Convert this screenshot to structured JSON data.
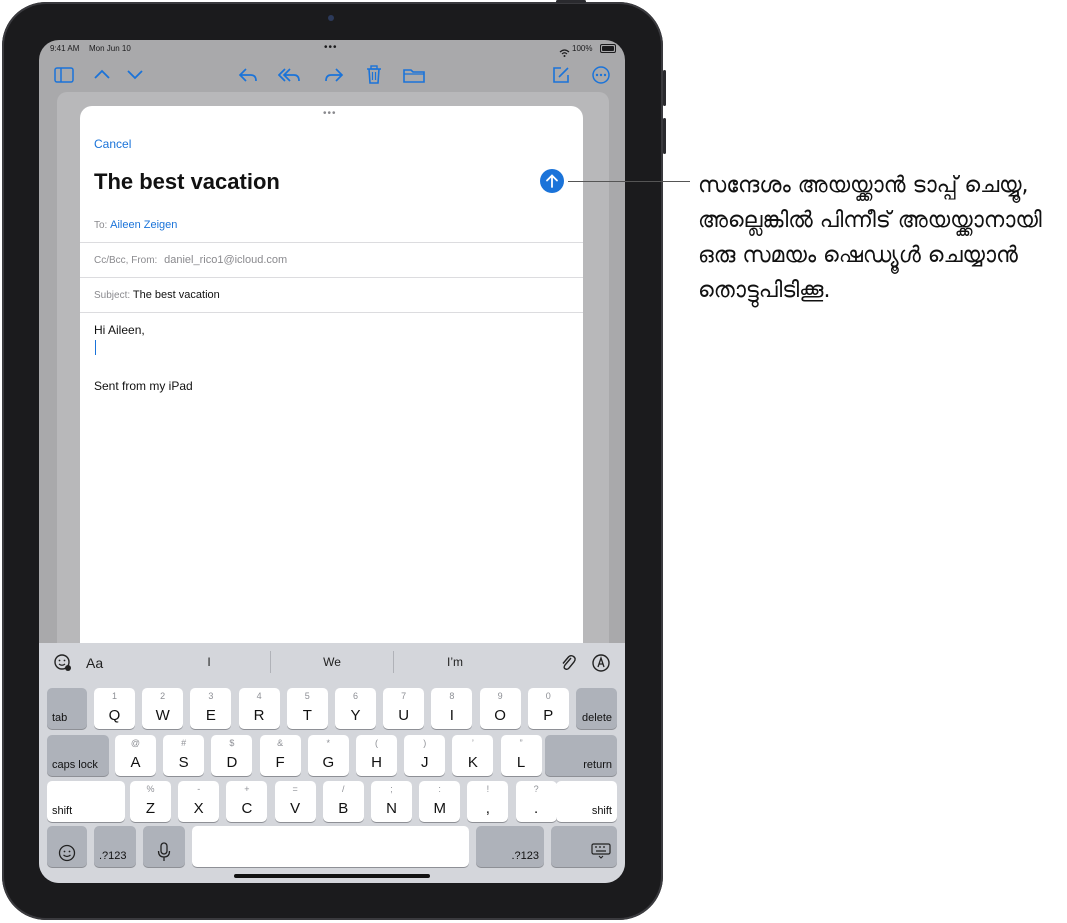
{
  "status": {
    "time": "9:41 AM",
    "date": "Mon Jun 10",
    "battery": "100%"
  },
  "toolbar_icons": [
    "sidebar-icon",
    "chevron-up-icon",
    "chevron-down-icon",
    "reply-icon",
    "reply-all-icon",
    "forward-icon",
    "trash-icon",
    "folder-icon",
    "compose-icon",
    "more-icon"
  ],
  "compose": {
    "cancel_label": "Cancel",
    "subject_title": "The best vacation",
    "to_label": "To:",
    "to_value": "Aileen Zeigen",
    "ccbcc_label": "Cc/Bcc, From:",
    "from_value": "daniel_rico1@icloud.com",
    "subject_label": "Subject:",
    "subject_value": "The best vacation",
    "body_greeting": "Hi Aileen,",
    "signature": "Sent from my iPad"
  },
  "keyboard": {
    "suggestions": [
      "I",
      "We",
      "I’m"
    ],
    "format_label": "Aa",
    "row1": [
      [
        "1",
        "Q"
      ],
      [
        "2",
        "W"
      ],
      [
        "3",
        "E"
      ],
      [
        "4",
        "R"
      ],
      [
        "5",
        "T"
      ],
      [
        "6",
        "Y"
      ],
      [
        "7",
        "U"
      ],
      [
        "8",
        "I"
      ],
      [
        "9",
        "O"
      ],
      [
        "0",
        "P"
      ]
    ],
    "row2": [
      [
        "@",
        "A"
      ],
      [
        "#",
        "S"
      ],
      [
        "$",
        "D"
      ],
      [
        "&",
        "F"
      ],
      [
        "*",
        "G"
      ],
      [
        "(",
        "H"
      ],
      [
        ")",
        "J"
      ],
      [
        "’",
        "K"
      ],
      [
        "”",
        "L"
      ]
    ],
    "row3": [
      [
        "%",
        "Z"
      ],
      [
        "-",
        "X"
      ],
      [
        "+",
        "C"
      ],
      [
        "=",
        "V"
      ],
      [
        "/",
        "B"
      ],
      [
        ";",
        "N"
      ],
      [
        ":",
        "M"
      ],
      [
        "!",
        ","
      ],
      [
        "?",
        "."
      ]
    ],
    "tab": "tab",
    "delete": "delete",
    "caps": "caps lock",
    "return": "return",
    "shift": "shift",
    "numbers": ".?123"
  },
  "callout_text": "സന്ദേശം അയയ്ക്കാൻ ടാപ്പ് ചെയ്യൂ, അല്ലെങ്കിൽ പിന്നീട് അയയ്ക്കാനായി ഒരു സമയം ഷെഡ്യൂൾ ചെയ്യാൻ തൊട്ടുപിടിക്കൂ.",
  "colors": {
    "accent": "#1a73d9",
    "keyboard_bg": "#d4d6db",
    "device": "#1b1b1d"
  }
}
